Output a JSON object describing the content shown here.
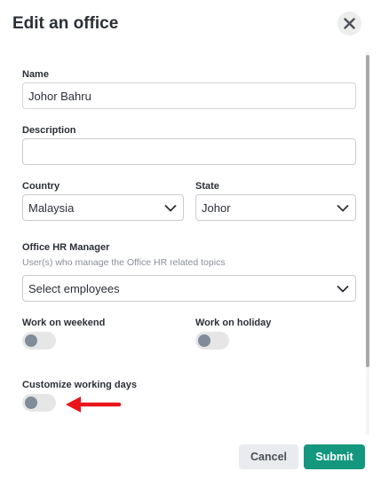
{
  "dialog": {
    "title": "Edit an office"
  },
  "form": {
    "name": {
      "label": "Name",
      "value": "Johor Bahru"
    },
    "description": {
      "label": "Description",
      "value": ""
    },
    "country": {
      "label": "Country",
      "value": "Malaysia"
    },
    "state": {
      "label": "State",
      "value": "Johor"
    },
    "hr_manager": {
      "label": "Office HR Manager",
      "hint": "User(s) who manage the Office HR related topics",
      "placeholder": "Select employees"
    },
    "work_on_weekend": {
      "label": "Work on weekend",
      "on": false
    },
    "work_on_holiday": {
      "label": "Work on holiday",
      "on": false
    },
    "customize_working_days": {
      "label": "Customize working days",
      "on": false
    }
  },
  "footer": {
    "cancel_label": "Cancel",
    "submit_label": "Submit"
  },
  "colors": {
    "accent": "#14977e",
    "annotation_arrow": "#e8151b",
    "toggle_off_track": "#e6e6e6",
    "toggle_off_knob": "#7f8c99"
  },
  "icons": {
    "close": "close-icon",
    "dropdown": "chevron-down-icon",
    "annotation": "red-arrow-icon"
  }
}
